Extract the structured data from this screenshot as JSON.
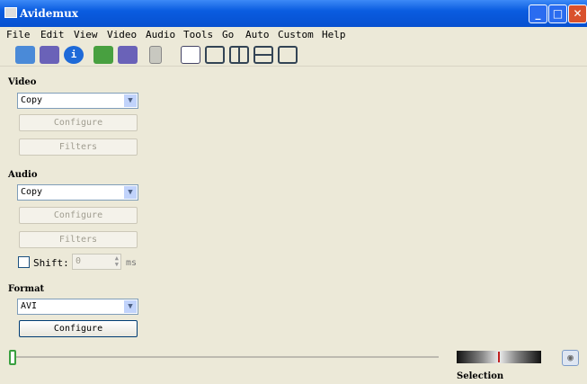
{
  "window": {
    "title": "Avidemux"
  },
  "menu": [
    "File",
    "Edit",
    "View",
    "Video",
    "Audio",
    "Tools",
    "Go",
    "Auto",
    "Custom",
    "Help"
  ],
  "toolbar": {
    "icons": [
      "open-icon",
      "save-icon",
      "info-icon",
      "open-folder-icon",
      "save-video-icon",
      "calculator-icon",
      "input-view-icon",
      "output-view-icon",
      "side-by-side-view-icon",
      "top-bottom-view-icon",
      "window-view-icon"
    ]
  },
  "video": {
    "label": "Video",
    "codec": "Copy",
    "configure": "Configure",
    "filters": "Filters"
  },
  "audio": {
    "label": "Audio",
    "codec": "Copy",
    "configure": "Configure",
    "filters": "Filters",
    "shift_label": "Shift:",
    "shift_value": "0",
    "shift_unit": "ms",
    "shift_checked": false
  },
  "format": {
    "label": "Format",
    "value": "AVI",
    "configure": "Configure"
  },
  "selection": {
    "label": "Selection"
  },
  "timeline": {
    "position": 0
  }
}
